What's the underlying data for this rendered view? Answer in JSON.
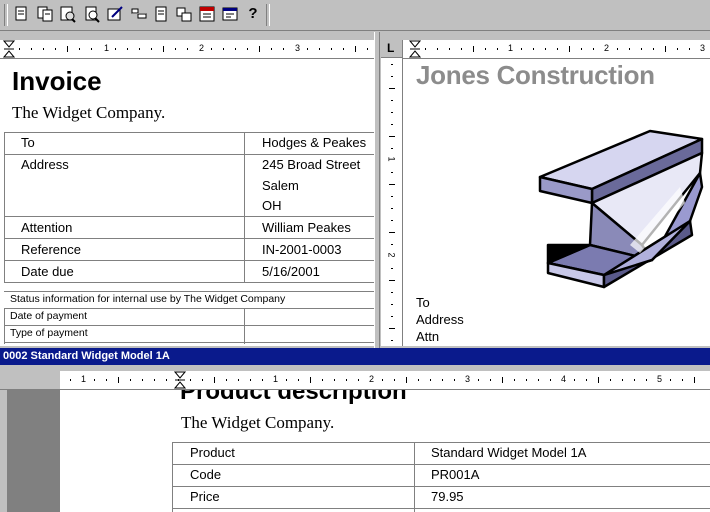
{
  "toolbar": {
    "buttons": [
      {
        "icon": "new-document-icon"
      },
      {
        "icon": "copy-document-icon"
      },
      {
        "icon": "print-preview-icon"
      },
      {
        "icon": "zoom-icon"
      },
      {
        "icon": "edit-icon"
      },
      {
        "icon": "split-horizontal-icon"
      },
      {
        "icon": "split-vertical-icon"
      },
      {
        "icon": "window-layout-icon"
      },
      {
        "icon": "date-field-icon"
      },
      {
        "icon": "properties-icon"
      },
      {
        "icon": "help-icon"
      }
    ],
    "help_glyph": "?"
  },
  "ruler_top_left": {
    "numbers": [
      "1",
      "2",
      "3"
    ]
  },
  "ruler_top_right": {
    "numbers": [
      "1",
      "2",
      "3"
    ],
    "tab_glyph": "L"
  },
  "ruler_vertical": {
    "numbers": [
      "1",
      "2"
    ]
  },
  "invoice": {
    "title": "Invoice",
    "company": "The Widget Company.",
    "rows": [
      {
        "label": "To",
        "value": "Hodges & Peakes"
      },
      {
        "label": "Address",
        "value": "245 Broad Street"
      },
      {
        "label": "",
        "value": "Salem"
      },
      {
        "label": "",
        "value": "OH"
      },
      {
        "label": "Attention",
        "value": "William Peakes"
      },
      {
        "label": "Reference",
        "value": "IN-2001-0003"
      },
      {
        "label": "Date due",
        "value": "5/16/2001"
      }
    ],
    "status_header": "Status information for internal use by The Widget Company",
    "status_rows": [
      {
        "label": "Date of payment",
        "value": ""
      },
      {
        "label": "Type of payment",
        "value": ""
      }
    ]
  },
  "letter": {
    "company": "Jones Construction",
    "fields": [
      "To",
      "Address",
      "Attn"
    ]
  },
  "doc_title": "0002 Standard Widget Model 1A",
  "ruler_bottom": {
    "numbers": [
      "1",
      "1",
      "2",
      "3",
      "4",
      "5"
    ]
  },
  "product": {
    "title": "Product description",
    "company": "The Widget Company.",
    "rows": [
      {
        "label": "Product",
        "value": "Standard Widget Model 1A"
      },
      {
        "label": "Code",
        "value": "PR001A"
      },
      {
        "label": "Price",
        "value": "79.95"
      }
    ]
  }
}
